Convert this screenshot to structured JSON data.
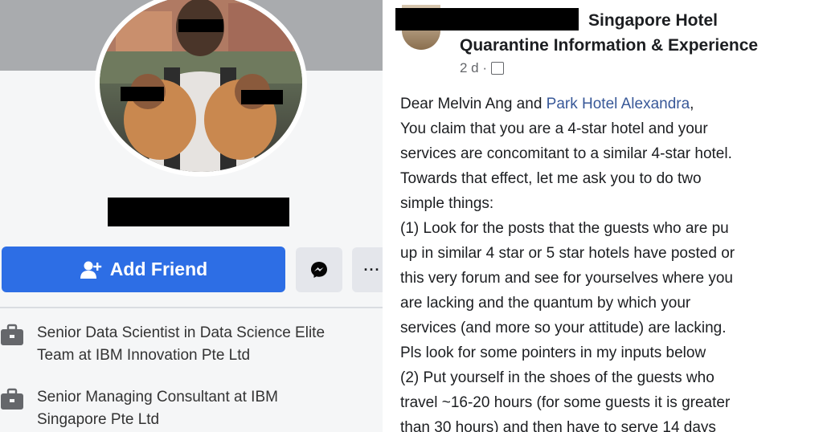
{
  "profile": {
    "add_friend_label": "Add Friend",
    "more_label": "···",
    "work": [
      {
        "line1": "Senior Data Scientist in Data Science Elite",
        "line2": "Team at IBM Innovation Pte Ltd"
      },
      {
        "line1": "Senior Managing Consultant at IBM",
        "line2": "Singapore Pte Ltd"
      }
    ]
  },
  "post": {
    "group_line1": "Singapore Hotel",
    "group_line2": "Quarantine Information & Experience",
    "timestamp": "2 d ·",
    "greeting_prefix": "Dear Melvin Ang and ",
    "greeting_link": "Park Hotel Alexandra",
    "greeting_suffix": ",",
    "lines": [
      "You claim that you are a 4-star hotel and your",
      "services are concomitant to a similar 4-star hotel.",
      "Towards that effect, let me ask you to do two",
      "simple things:",
      "(1)   Look for the posts that the guests who are pu",
      "up in similar 4 star or 5 star hotels  have posted or",
      "this very forum and see for yourselves where you",
      "are lacking and the quantum by which your",
      "services (and more so your attitude) are lacking.",
      "Pls look for some pointers in my inputs below",
      "(2)  Put yourself in the shoes of the guests who",
      "travel ~16-20 hours (for  some guests it is greater",
      "than 30 hours) and then have to serve 14 days"
    ]
  },
  "colors": {
    "fb_blue": "#2d6ee5",
    "link": "#385898",
    "gray_btn": "#e4e6eb"
  }
}
